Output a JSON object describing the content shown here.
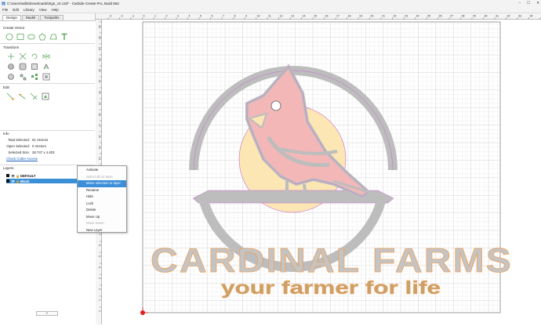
{
  "window": {
    "title": "C:\\Users\\willa\\Downloads\\Sign_v2.c2d* - Carbide Create Pro, Build 862",
    "controls": [
      "–",
      "☐",
      "✕"
    ]
  },
  "menu": [
    "File",
    "Edit",
    "Library",
    "View",
    "Help"
  ],
  "tabs": [
    {
      "label": "Design",
      "active": true
    },
    {
      "label": "Model",
      "active": false
    },
    {
      "label": "Toolpaths",
      "active": false
    }
  ],
  "sections": {
    "create_vector": "Create Vector",
    "transform": "Transform",
    "edit": "Edit",
    "info": "Info",
    "layers": "Layers"
  },
  "info": {
    "total_selected_label": "Total Selected:",
    "total_selected_value": "61 Vectors",
    "open_selected_label": "Open Selected:",
    "open_selected_value": "0 Vectors",
    "selected_size_label": "Selected Size:",
    "selected_size_value": "28.747 x 4.403",
    "check_cutter_link": "Check Cutter Access"
  },
  "layers": [
    {
      "name": "DEFAULT",
      "selected": false
    },
    {
      "name": "Black",
      "selected": true
    }
  ],
  "add_layer_button": "+",
  "context_menu": [
    {
      "label": "Activate",
      "state": "normal"
    },
    {
      "label": "Select all on layer",
      "state": "disabled"
    },
    {
      "label": "Move selection to layer",
      "state": "highlighted"
    },
    {
      "label": "Rename",
      "state": "normal"
    },
    {
      "label": "Hide",
      "state": "normal"
    },
    {
      "label": "Lock",
      "state": "normal"
    },
    {
      "label": "Delete",
      "state": "normal"
    },
    {
      "label": "Move Up",
      "state": "normal"
    },
    {
      "label": "Move Down",
      "state": "disabled"
    },
    {
      "label": "New Layer",
      "state": "normal"
    }
  ],
  "ruler": {
    "top_ticks": [
      "-3",
      "-2",
      "-1",
      "0",
      "1",
      "2",
      "3",
      "4",
      "5",
      "6",
      "7",
      "8",
      "9",
      "10",
      "11",
      "12",
      "13",
      "14",
      "15",
      "16",
      "17",
      "18",
      "19",
      "20",
      "21",
      "22",
      "23",
      "24",
      "25",
      "26",
      "27",
      "28",
      "29",
      "30",
      "31",
      "32",
      "33",
      "34",
      "35"
    ],
    "left_ticks": [
      "26",
      "25",
      "24",
      "23",
      "22",
      "21",
      "20",
      "19",
      "18",
      "17",
      "16",
      "15",
      "14",
      "13",
      "12",
      "11",
      "10",
      "9",
      "8",
      "7",
      "6",
      "5",
      "4",
      "3",
      "2",
      "1",
      "0"
    ]
  },
  "design": {
    "headline": "CARDINAL FARMS",
    "tagline": "your farmer for life"
  },
  "colors": {
    "selection_blue": "#3a8fd6",
    "sun_yellow": "#fbe6b4",
    "bird_pink": "#f3b7b7",
    "outline_gray": "#bdbdbd",
    "vector_magenta": "#c86ad6",
    "text_orange": "#f0a25a"
  }
}
